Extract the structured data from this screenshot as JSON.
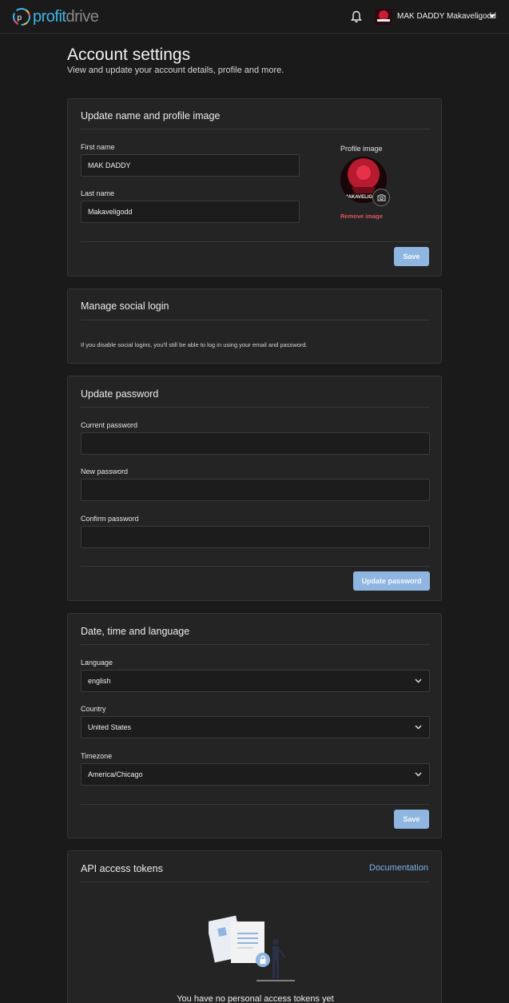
{
  "header": {
    "logo_part1": "profit",
    "logo_part2": "drive",
    "user_name": "MAK DADDY Makaveligodd"
  },
  "page": {
    "title": "Account settings",
    "subtitle": "View and update your account details, profile and more."
  },
  "profile_card": {
    "title": "Update name and profile image",
    "first_name_label": "First name",
    "first_name_value": "MAK DADDY",
    "last_name_label": "Last name",
    "last_name_value": "Makaveligodd",
    "profile_image_label": "Profile image",
    "avatar_text": "MAKAVELIGODD",
    "remove_image": "Remove image",
    "save_label": "Save"
  },
  "social_card": {
    "title": "Manage social login",
    "help": "If you disable social logins, you'll still be able to log in using your email and password."
  },
  "password_card": {
    "title": "Update password",
    "current_label": "Current password",
    "new_label": "New password",
    "confirm_label": "Confirm password",
    "current_value": "",
    "new_value": "",
    "confirm_value": "",
    "submit_label": "Update password"
  },
  "locale_card": {
    "title": "Date, time and language",
    "language_label": "Language",
    "language_value": "english",
    "country_label": "Country",
    "country_value": "United States",
    "timezone_label": "Timezone",
    "timezone_value": "America/Chicago",
    "save_label": "Save"
  },
  "api_card": {
    "title": "API access tokens",
    "doc_link": "Documentation",
    "empty_text": "You have no personal access tokens yet"
  },
  "colors": {
    "background": "#1a1a1a",
    "card": "#242424",
    "primary_button": "#8fb6e0",
    "link": "#7fb0e6",
    "danger": "#e0555c"
  },
  "icons": [
    "profitdrive-logo-icon",
    "bell-icon",
    "caret-down-icon",
    "camera-icon",
    "chevron-down-icon",
    "tokens-empty-illustration"
  ]
}
